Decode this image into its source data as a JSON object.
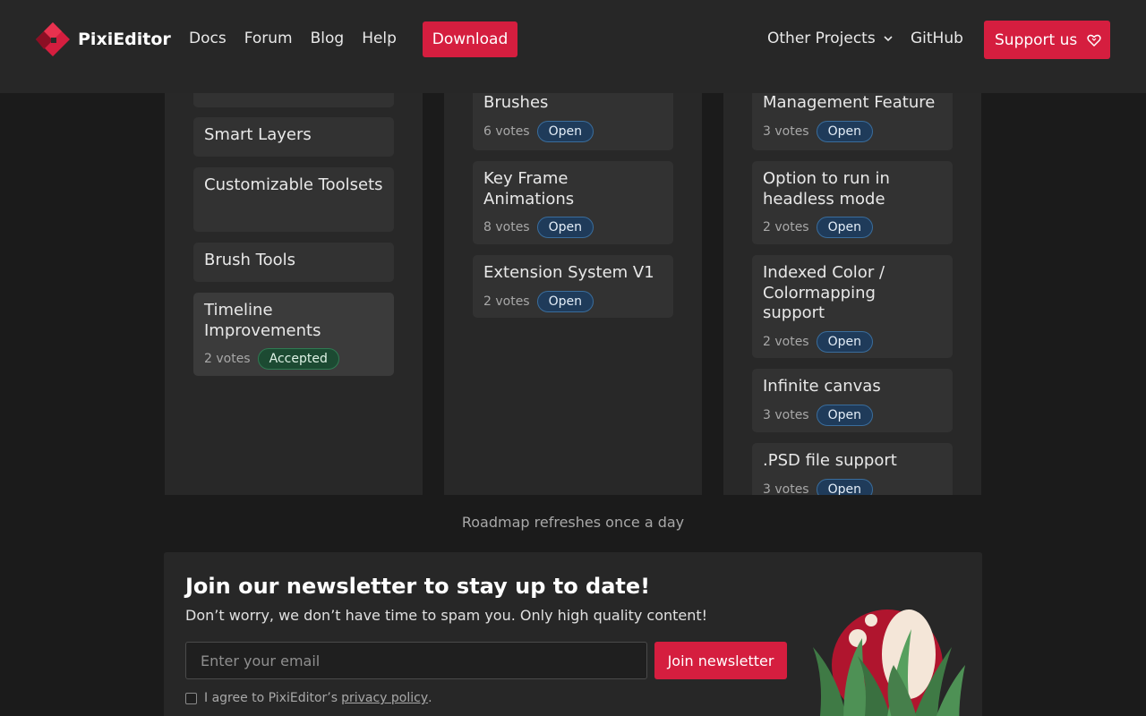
{
  "header": {
    "brand": "PixiEditor",
    "nav": [
      "Docs",
      "Forum",
      "Blog",
      "Help"
    ],
    "download_label": "Download",
    "other_projects_label": "Other Projects",
    "github_label": "GitHub",
    "support_label": "Support us",
    "brand_color": "#d51e3f"
  },
  "columns": [
    {
      "cards": [
        {
          "title": "",
          "votes": "",
          "status": ""
        },
        {
          "title": "Smart Layers",
          "votes": "",
          "status": ""
        },
        {
          "title": "Customizable Toolsets",
          "votes": "",
          "status": ""
        },
        {
          "title": "Brush Tools",
          "votes": "",
          "status": ""
        },
        {
          "title": "Timeline Improvements",
          "votes": "2 votes",
          "status": "Accepted"
        }
      ]
    },
    {
      "cards": [
        {
          "title": "Brushes",
          "votes": "6 votes",
          "status": "Open"
        },
        {
          "title": "Key Frame Animations",
          "votes": "8 votes",
          "status": "Open"
        },
        {
          "title": "Extension System V1",
          "votes": "2 votes",
          "status": "Open"
        }
      ]
    },
    {
      "cards": [
        {
          "title": "Management Feature",
          "votes": "3 votes",
          "status": "Open"
        },
        {
          "title": "Option to run in headless mode",
          "votes": "2 votes",
          "status": "Open"
        },
        {
          "title": "Indexed Color / Colormapping support",
          "votes": "2 votes",
          "status": "Open"
        },
        {
          "title": "Infinite canvas",
          "votes": "3 votes",
          "status": "Open"
        },
        {
          "title": ".PSD file support",
          "votes": "3 votes",
          "status": "Open"
        }
      ]
    }
  ],
  "refresh_note": "Roadmap refreshes once a day",
  "newsletter": {
    "title": "Join our newsletter to stay up to date!",
    "subtitle": "Don’t worry, we don’t have time to spam you. Only high quality content!",
    "email_placeholder": "Enter your email",
    "email_value": "",
    "join_label": "Join newsletter",
    "agree_text": "I agree to PixiEditor’s",
    "privacy_link": "privacy policy",
    "agree_suffix": ".",
    "agree_checked": false
  },
  "icons": {
    "logo": "pixieditor-logo-icon",
    "chevron": "chevron-down-icon",
    "support": "heart-icon",
    "mascot": "mushroom-mascot-illustration"
  },
  "colors": {
    "open_badge": "#1f3b5a",
    "accepted_badge": "#1c4a32"
  }
}
